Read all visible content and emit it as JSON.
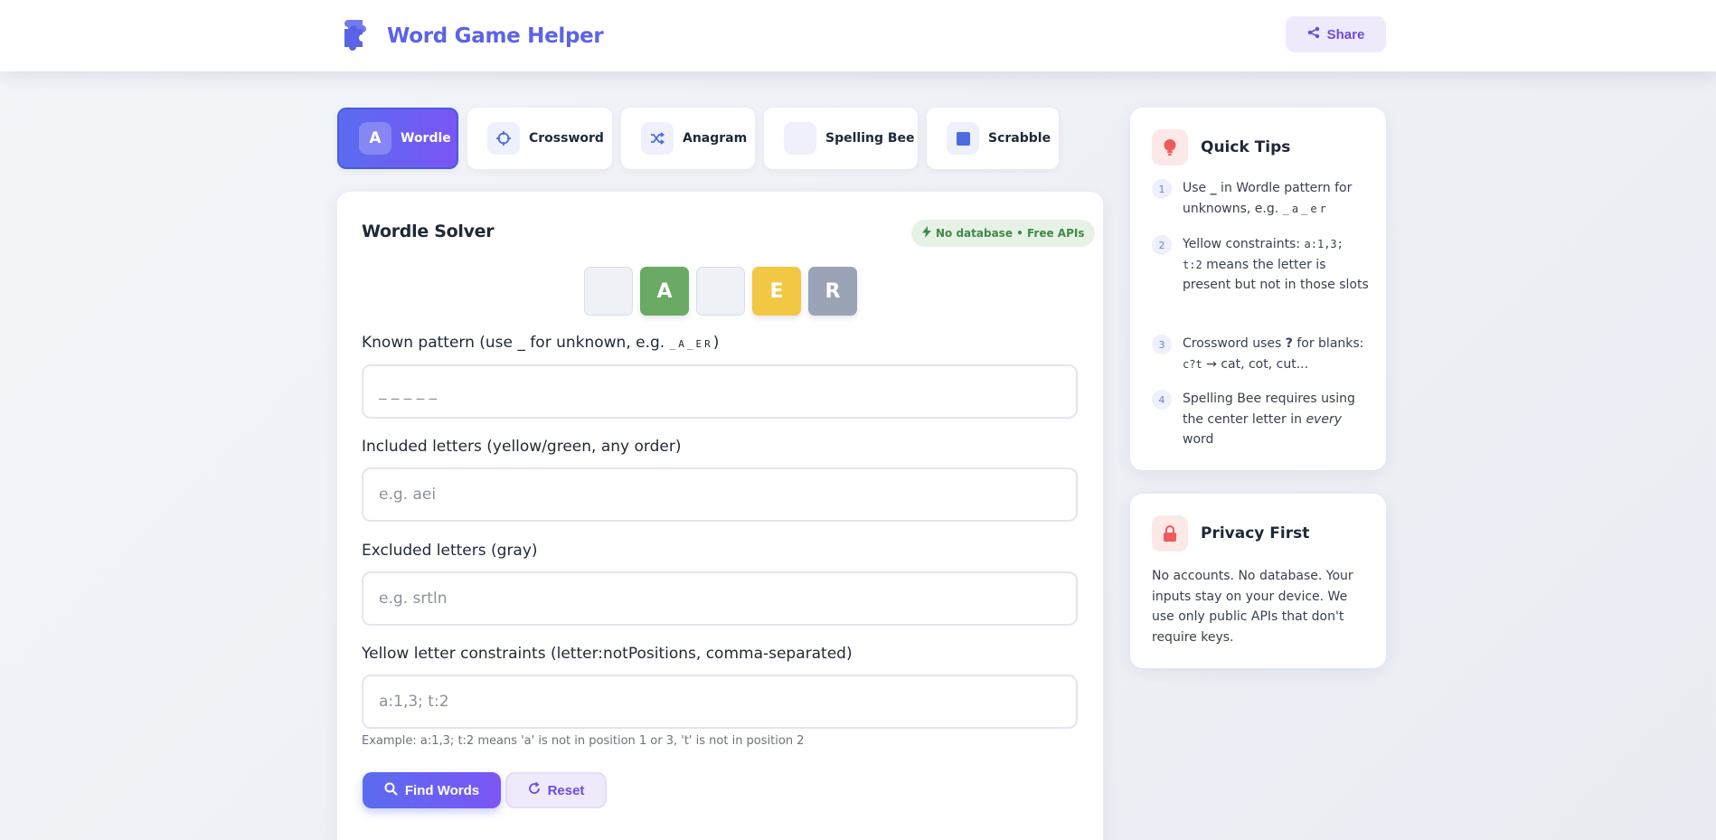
{
  "header": {
    "title": "Word Game Helper",
    "share_label": "Share"
  },
  "tabs": [
    {
      "label": "Wordle",
      "icon": "letter-a-icon",
      "icon_text": "A",
      "active": true
    },
    {
      "label": "Crossword",
      "icon": "crosshair-icon",
      "active": false
    },
    {
      "label": "Anagram",
      "icon": "shuffle-icon",
      "active": false
    },
    {
      "label": "Spelling Bee",
      "icon": "blank-icon",
      "active": false
    },
    {
      "label": "Scrabble",
      "icon": "square-icon",
      "active": false
    }
  ],
  "solver": {
    "title": "Wordle Solver",
    "badge": "No database • Free APIs",
    "tiles": [
      {
        "letter": "",
        "color": "#eef2f7"
      },
      {
        "letter": "A",
        "color": "#6aaa64"
      },
      {
        "letter": "",
        "color": "#eef2f7"
      },
      {
        "letter": "E",
        "color": "#f2c744"
      },
      {
        "letter": "R",
        "color": "#9aa4b6"
      }
    ],
    "pattern_label_prefix": "Known pattern (use _ for unknown, e.g. ",
    "pattern_label_example": "_A_ER",
    "pattern_label_suffix": ")",
    "pattern_placeholder": "_ _ _ _ _",
    "included_label": "Included letters (yellow/green, any order)",
    "included_placeholder": "e.g. aei",
    "excluded_label": "Excluded letters (gray)",
    "excluded_placeholder": "e.g. srtln",
    "constraints_label": "Yellow letter constraints (letter:notPositions, comma-separated)",
    "constraints_placeholder": "a:1,3; t:2",
    "hint": "Example: a:1,3; t:2 means 'a' is not in position 1 or 3, 't' is not in position 2",
    "find_label": "Find Words",
    "reset_label": "Reset"
  },
  "tips": {
    "title": "Quick Tips",
    "items": [
      {
        "num": "1",
        "a": "Use ",
        "b": "_",
        "c": " in Wordle pattern for unknowns, e.g. ",
        "d": "_a_er"
      },
      {
        "num": "2",
        "a": "Yellow constraints: ",
        "b": "a:1,3; t:2",
        "c": " means the letter is present but not in those slots"
      },
      {
        "num": "3",
        "a": "Crossword uses ",
        "b": "?",
        "c": " for blanks: ",
        "d": "c?t",
        "e": " → cat, cot, cut..."
      },
      {
        "num": "4",
        "a": "Spelling Bee requires using the center letter in ",
        "b": "every",
        "c": " word"
      }
    ]
  },
  "privacy": {
    "title": "Privacy First",
    "text": "No accounts. No database. Your inputs stay on your device. We use only public APIs that don't require keys."
  },
  "colors": {
    "accent": "#5b63e8",
    "accent2": "#7b55f4",
    "green": "#6aaa64",
    "yellow": "#f2c744",
    "gray": "#9aa4b6"
  }
}
